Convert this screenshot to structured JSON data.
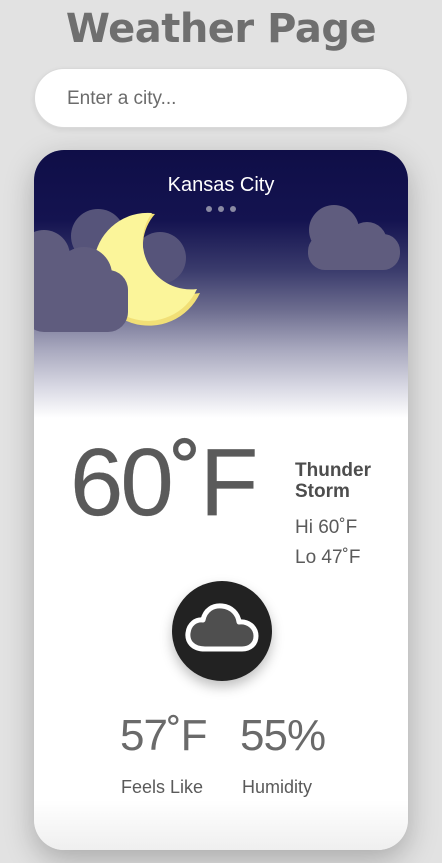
{
  "header": {
    "title": "Weather Page"
  },
  "search": {
    "placeholder": "Enter a city..."
  },
  "weather": {
    "city": "Kansas City",
    "temperature": "60˚F",
    "condition": "Thunder Storm",
    "high": "Hi 60˚F",
    "low": "Lo 47˚F",
    "icon": "cloud-icon",
    "feels_like_value": "57˚F",
    "feels_like_label": "Feels Like",
    "humidity_value": "55%",
    "humidity_label": "Humidity"
  },
  "colors": {
    "night_sky": "#0f0e47",
    "moon": "#fbf59a",
    "cloud": "#5f5c7e",
    "icon_circle": "#222222"
  }
}
